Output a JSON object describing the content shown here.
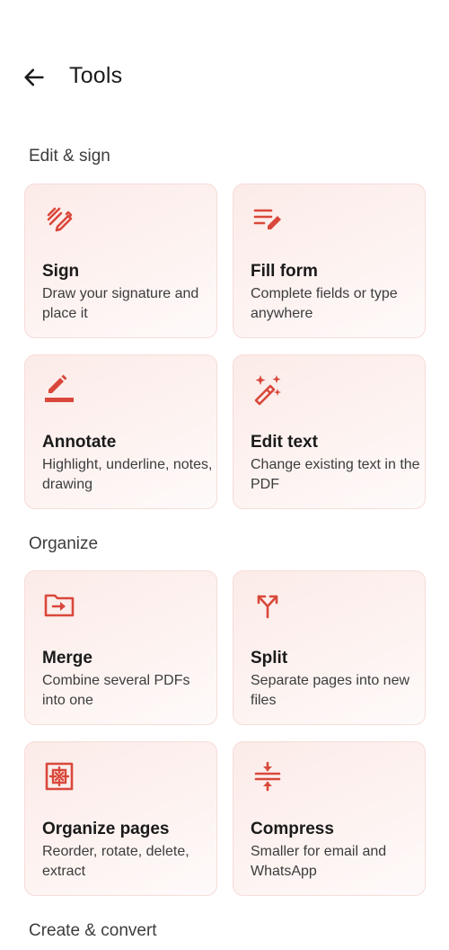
{
  "header": {
    "title": "Tools",
    "back_icon": "arrow-left-icon"
  },
  "sections": [
    {
      "title": "Edit & sign",
      "tools": [
        {
          "title": "Sign",
          "description": "Draw your signature and place it",
          "icon": "signature-icon"
        },
        {
          "title": "Fill form",
          "description": "Complete fields or type anywhere",
          "icon": "form-edit-icon"
        },
        {
          "title": "Annotate",
          "description": "Highlight, underline, notes, drawing",
          "icon": "pen-underline-icon"
        },
        {
          "title": "Edit text",
          "description": "Change existing text in the PDF",
          "icon": "magic-wand-icon"
        }
      ]
    },
    {
      "title": "Organize",
      "tools": [
        {
          "title": "Merge",
          "description": "Combine several PDFs into one",
          "icon": "folder-arrow-icon"
        },
        {
          "title": "Split",
          "description": "Separate pages into new files",
          "icon": "split-arrows-icon"
        },
        {
          "title": "Organize pages",
          "description": "Reorder, rotate, delete, extract",
          "icon": "organize-pages-icon"
        },
        {
          "title": "Compress",
          "description": "Smaller for email and WhatsApp",
          "icon": "compress-icon"
        }
      ]
    },
    {
      "title": "Create & convert"
    }
  ],
  "colors": {
    "accent": "#d9483b",
    "card_border": "#f6dcd8",
    "card_bg": "#fcebe8"
  }
}
